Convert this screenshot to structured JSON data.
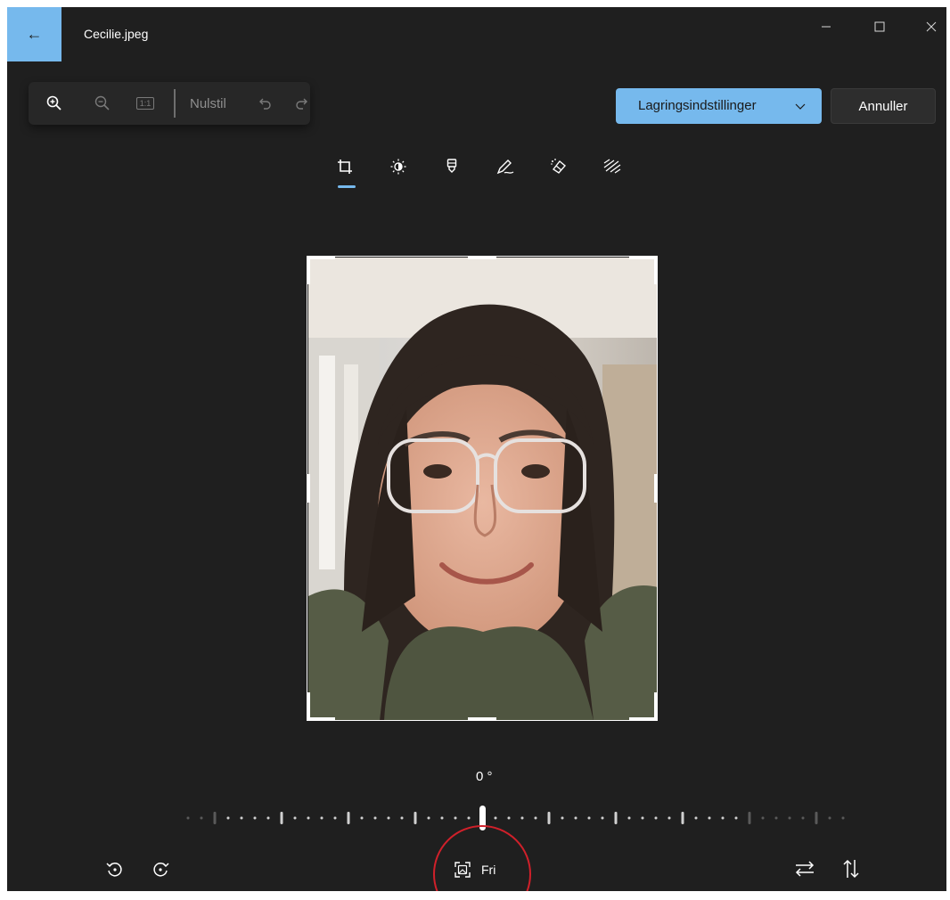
{
  "window": {
    "title": "Cecilie.jpeg",
    "back_icon": "arrow-left-icon",
    "controls": [
      "minimize-icon",
      "maximize-icon",
      "close-icon"
    ]
  },
  "zoom_toolbar": {
    "icons": [
      "zoom-in-icon",
      "zoom-out-icon",
      "actual-size-icon",
      "undo-icon",
      "redo-icon"
    ],
    "actual_size_text": "1:1",
    "reset_label": "Nulstil"
  },
  "actions": {
    "save_label": "Lagringsindstillinger",
    "cancel_label": "Annuller",
    "accent_color": "#76b9ed"
  },
  "edit_tools": {
    "items": [
      "crop-icon",
      "brightness-icon",
      "markup-icon",
      "draw-icon",
      "erase-icon",
      "background-icon"
    ],
    "active": "crop-icon"
  },
  "crop": {
    "angle_label": "0 °",
    "aspect_label": "Fri",
    "rotate_icons": [
      "rotate-left-icon",
      "rotate-right-icon"
    ],
    "flip_icons": [
      "flip-horizontal-icon",
      "flip-vertical-icon"
    ]
  },
  "annotation": {
    "circle_color": "#d0202a"
  }
}
